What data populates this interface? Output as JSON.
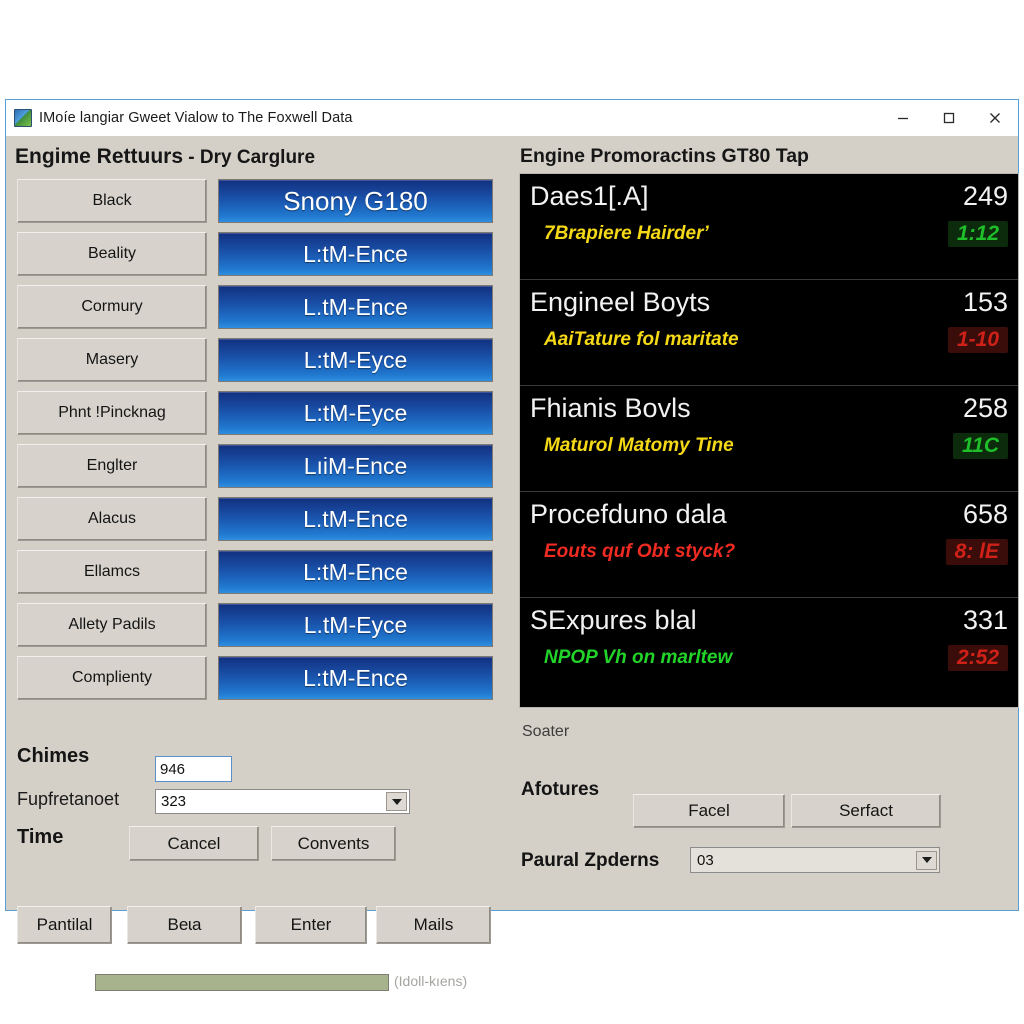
{
  "window": {
    "title": "IMoíe langiar Gweet Vialow to The Foxwell Data",
    "icon": "app-icon",
    "controls": {
      "minimize": "minimize-icon",
      "maximize": "maximize-icon",
      "close": "close-icon"
    }
  },
  "left": {
    "title_main": "Engime Rettuurs",
    "title_sep": " - ",
    "title_sub": "Dry Carglure",
    "grey_buttons": [
      "Black",
      "Beality",
      "Cormury",
      "Masery",
      "Phnt !Pincknag",
      "Englter",
      "Alacus",
      "Ellamcs",
      "Allety Padils",
      "Complienty"
    ],
    "blue_buttons": [
      "Snony G180",
      "L:tM-Ence",
      "L.tM-Ence",
      "L:tM-Eyce",
      "L:tM-Eyce",
      "LıiM-Ence",
      "L.tM-Ence",
      "L:tM-Ence",
      "L.tM-Eyce",
      "L:tM-Ence"
    ],
    "chimes_label": "Chimes",
    "chimes_value": "946",
    "freq_label": "Fupfretanoet",
    "freq_value": "323",
    "time_label": "Time",
    "cancel_label": "Cancel",
    "converts_label": "Convents",
    "progress_label": "(Idoll-kıens)",
    "progress_percent": 100,
    "bottom_buttons": [
      "Pantilal",
      "Beɩa",
      "Enter",
      "Mails"
    ]
  },
  "right": {
    "title": "Engine Promoractins GT80 Tap",
    "rows": [
      {
        "name": "Daes1[.A]",
        "value": "249",
        "sub": "7Brapiere  Hairderʼ",
        "sub_color": "yellow",
        "badge": "1:12",
        "badge_color": "green"
      },
      {
        "name": "Engineel Boyts",
        "value": "153",
        "sub": "AaiTature fol maritate",
        "sub_color": "yellow",
        "badge": "1-10",
        "badge_color": "red"
      },
      {
        "name": "Fhianis Bovls",
        "value": "258",
        "sub": "Maturol Matomy Tine",
        "sub_color": "yellow",
        "badge": "11C",
        "badge_color": "green"
      },
      {
        "name": "Procefduno dala",
        "value": "658",
        "sub": "Eouts quf Obt styck?",
        "sub_color": "red",
        "badge": "8: lE",
        "badge_color": "red"
      },
      {
        "name": "SExpures blal",
        "value": "331",
        "sub": "NPOP Vh on marltew",
        "sub_color": "green",
        "badge": "2:52",
        "badge_color": "red"
      }
    ],
    "soater_label": "Soater",
    "afotures_label": "Afotures",
    "facel_label": "Facel",
    "serfact_label": "Serfact",
    "paural_label": "Paural Zpderns",
    "paural_value": "03"
  },
  "colors": {
    "window_chrome": "#d4d0c8",
    "accent_blue": "#1a52ab",
    "display_bg": "#000000",
    "status_green": "#22d42a",
    "status_red": "#ef2b22",
    "status_yellow": "#f5d916",
    "progress_fill": "#a7b38c"
  }
}
